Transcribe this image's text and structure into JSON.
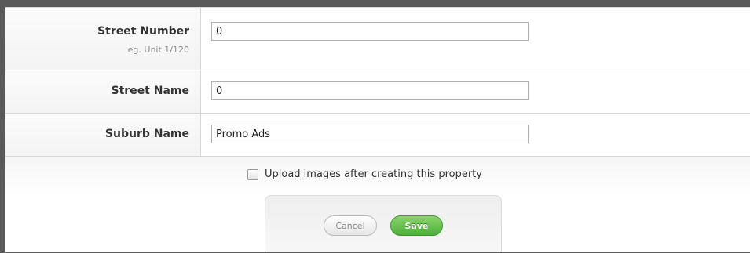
{
  "form": {
    "fields": [
      {
        "label": "Street Number",
        "hint": "eg. Unit 1/120",
        "value": "0"
      },
      {
        "label": "Street Name",
        "value": "0"
      },
      {
        "label": "Suburb Name",
        "value": "Promo Ads"
      }
    ],
    "upload_checkbox": {
      "label": "Upload images after creating this property",
      "checked": false
    },
    "buttons": {
      "cancel_label": "Cancel",
      "save_label": "Save"
    }
  },
  "colors": {
    "save_button": "#4caf37",
    "frame": "#5a5a5a"
  },
  "icons": {
    "checkbox": "checkbox-unchecked-icon"
  }
}
